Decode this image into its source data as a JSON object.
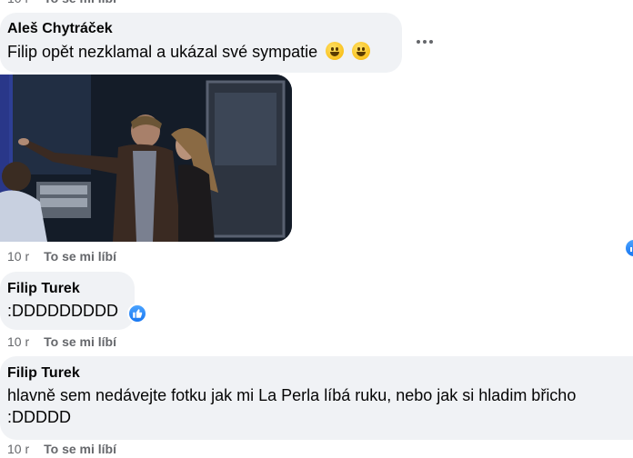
{
  "comments": [
    {
      "author": "Aleš Chytráček",
      "text": "Filip opět nezklamal a ukázal své sympatie",
      "time": "10 r",
      "like_label": "To se mi líbí"
    },
    {
      "author": "Filip Turek",
      "text": ":DDDDDDDDD",
      "time": "10 r",
      "like_label": "To se mi líbí"
    },
    {
      "author": "Filip Turek",
      "text_line1": "hlavně sem nedávejte fotku jak mi La Perla líbá ruku, nebo jak si hladim břicho",
      "text_line2": ":DDDDD",
      "time": "10 r",
      "like_label": "To se mi líbí"
    }
  ],
  "colors": {
    "bubble": "#f0f2f5",
    "meta": "#65676b",
    "like_blue": "#1877f2"
  },
  "icons": [
    "grinning-face-emoji",
    "more-options-icon",
    "like-reaction-icon"
  ]
}
